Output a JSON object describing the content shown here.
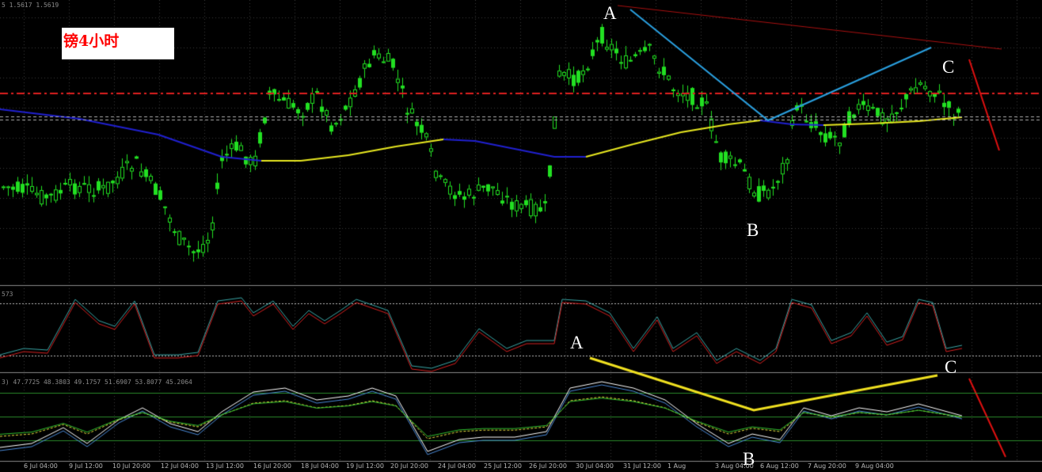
{
  "chart_data": [
    {
      "type": "candlestick",
      "title": "镑4小时",
      "pattern_labels": [
        "A",
        "B",
        "C"
      ],
      "header_text": "5 1.5617 1.5619",
      "overlays": [
        "moving-average",
        "support-line",
        "resistance-line",
        "abc-trendlines"
      ]
    },
    {
      "type": "line",
      "indicator": "stochastic oscillator",
      "header_text": "573",
      "series": [
        {
          "color": "#d42020"
        },
        {
          "color": "#3aa6a6"
        }
      ],
      "pattern_labels": [
        "A"
      ]
    },
    {
      "type": "line",
      "indicator": "multi-line oscillator",
      "header_text": "3) 47.7725 48.3803 49.1757 51.6907 53.8077 45.2064",
      "pattern_labels": [
        "B",
        "C"
      ]
    }
  ],
  "x_ticks": [
    "6 Jul 04:00",
    "9 Jul 12:00",
    "10 Jul 20:00",
    "12 Jul 04:00",
    "13 Jul 12:00",
    "16 Jul 20:00",
    "18 Jul 04:00",
    "19 Jul 12:00",
    "20 Jul 20:00",
    "24 Jul 04:00",
    "25 Jul 12:00",
    "26 Jul 20:00",
    "30 Jul 04:00",
    "31 Jul 12:00",
    "1 Aug",
    "3 Aug 04:00",
    "6 Aug 12:00",
    "7 Aug 20:00",
    "9 Aug 04:00"
  ],
  "colors": {
    "candle_up": "#22e022",
    "candle_down": "#22e022",
    "ma_line_down": "#2020d0",
    "ma_line_up": "#e8e820",
    "resistance": "#e02020",
    "support": "#b0b0b0",
    "trendline_price": "#2aa0e0",
    "trendline_osc": "#f0e020",
    "channel": "#aa1010",
    "arrow": "#e01010"
  }
}
